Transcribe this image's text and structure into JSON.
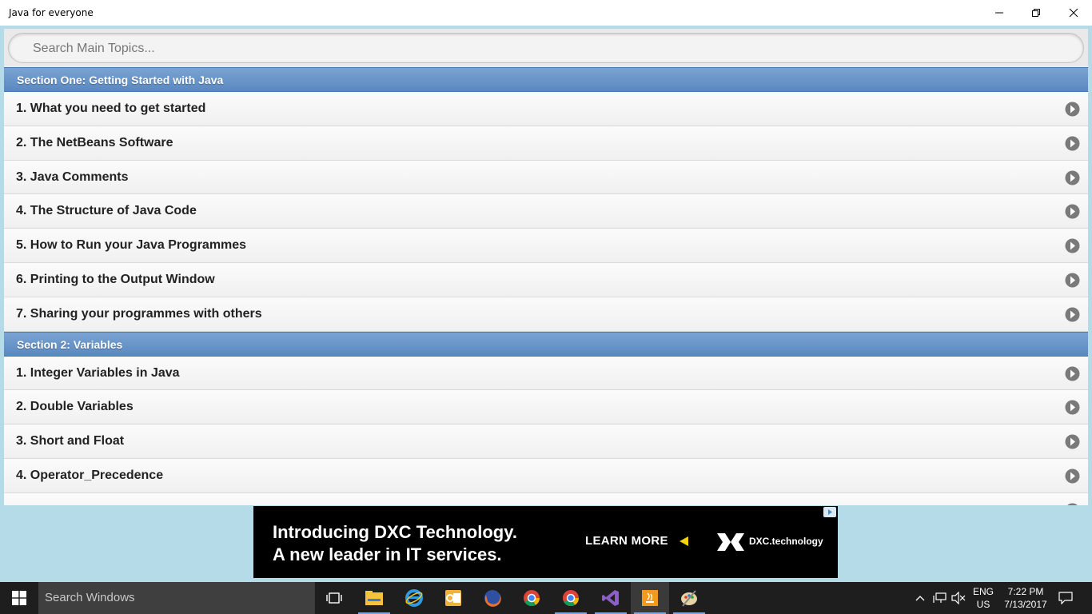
{
  "window": {
    "title": "Java for everyone"
  },
  "search": {
    "placeholder": "Search Main Topics..."
  },
  "sections": [
    {
      "title": "Section One: Getting Started with Java",
      "items": [
        "1. What you need to get started",
        "2. The NetBeans Software",
        "3. Java Comments",
        "4. The Structure of Java Code",
        "5. How to Run your Java Programmes",
        "6. Printing to the Output Window",
        "7. Sharing your programmes with others"
      ]
    },
    {
      "title": "Section 2: Variables",
      "items": [
        "1. Integer Variables in Java",
        "2. Double Variables",
        "3. Short and Float",
        "4. Operator_Precedence"
      ]
    }
  ],
  "ad": {
    "line1": "Introducing DXC Technology.",
    "line2": "A new leader in IT services.",
    "cta": "LEARN MORE",
    "brand": "DXC.technology"
  },
  "taskbar": {
    "search_text": "Search Windows",
    "language": "ENG",
    "region": "US",
    "time": "7:22 PM",
    "date": "7/13/2017"
  },
  "colors": {
    "section_header": "#5a88c0",
    "app_background": "#b6dbe8",
    "taskbar": "#1e1e1e"
  }
}
